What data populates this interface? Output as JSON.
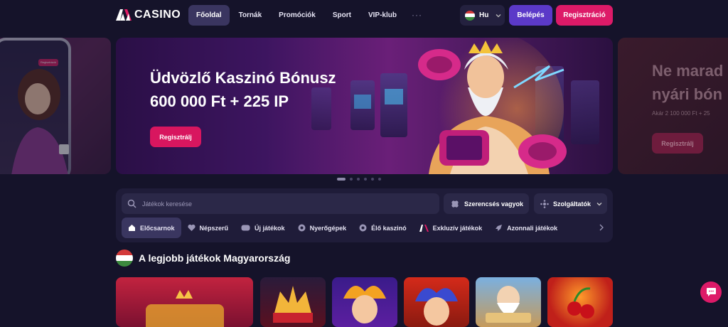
{
  "header": {
    "logo_text": "CASINO",
    "nav": [
      {
        "label": "Főoldal",
        "active": true
      },
      {
        "label": "Tornák"
      },
      {
        "label": "Promóciók"
      },
      {
        "label": "Sport"
      },
      {
        "label": "VIP-klub"
      }
    ],
    "more_label": "···",
    "language": "Hu",
    "login_label": "Belépés",
    "register_label": "Regisztráció"
  },
  "carousel": {
    "left_slide": {
      "button": "Regisztráció"
    },
    "main": {
      "title_line1": "Üdvözlő Kaszinó Bónusz",
      "title_line2": "600 000 Ft + 225 IP",
      "cta": "Regisztrálj"
    },
    "right_slide": {
      "title_line1": "Ne marad",
      "title_line2": "nyári bón",
      "subtitle": "Akár 2 100 000 Ft + 25",
      "cta": "Regisztrálj"
    },
    "dot_count": 6,
    "active_dot": 0
  },
  "search": {
    "placeholder": "Játékok keresése",
    "lucky_label": "Szerencsés vagyok",
    "providers_label": "Szolgáltatók"
  },
  "categories": [
    {
      "label": "Előcsarnok",
      "icon": "home-icon",
      "active": true
    },
    {
      "label": "Népszerű",
      "icon": "heart-icon"
    },
    {
      "label": "Új játékok",
      "icon": "new-icon"
    },
    {
      "label": "Nyerőgépek",
      "icon": "slots-icon"
    },
    {
      "label": "Élő kaszinó",
      "icon": "live-icon"
    },
    {
      "label": "Exkluzív játékok",
      "icon": "exclusive-icon"
    },
    {
      "label": "Azonnali játékok",
      "icon": "rocket-icon"
    }
  ],
  "section": {
    "title": "A legjobb játékok Magyarország"
  },
  "colors": {
    "bg": "#15132a",
    "accent_pink": "#dd1a68",
    "accent_purple": "#5b39c8",
    "panel": "#1f1c39"
  }
}
